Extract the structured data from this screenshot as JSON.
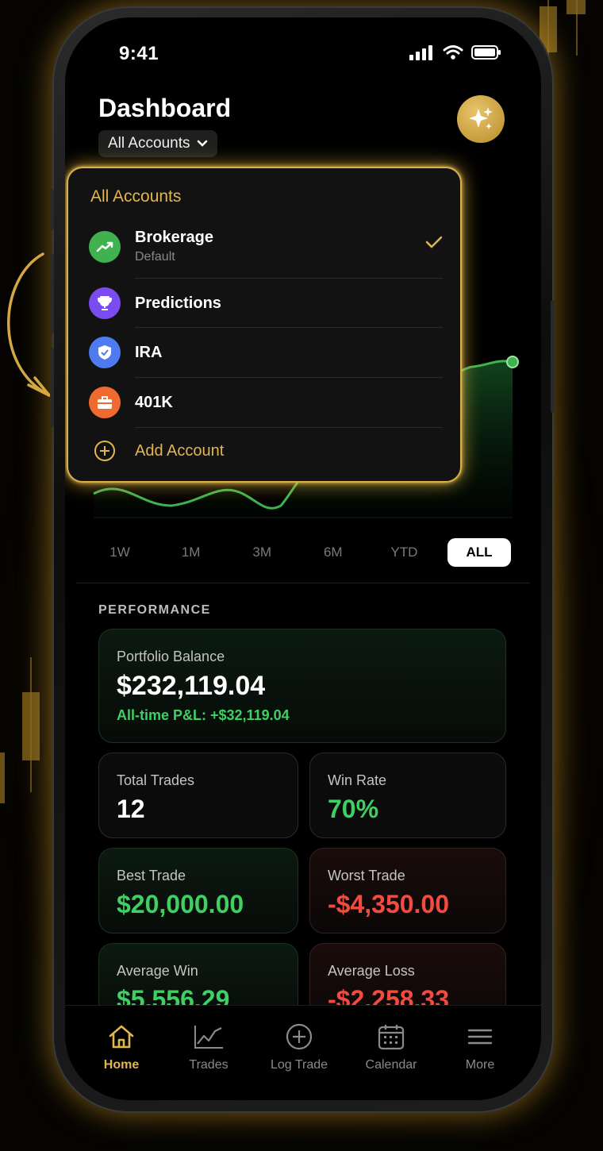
{
  "status_bar": {
    "time": "9:41"
  },
  "header": {
    "title": "Dashboard",
    "account_selector": "All Accounts"
  },
  "account_menu": {
    "header": "All Accounts",
    "items": [
      {
        "label": "Brokerage",
        "sublabel": "Default",
        "icon": "chart-up-icon",
        "color": "#3fb24f",
        "selected": true
      },
      {
        "label": "Predictions",
        "icon": "trophy-icon",
        "color": "#7a4cf0",
        "selected": false
      },
      {
        "label": "IRA",
        "icon": "shield-icon",
        "color": "#4f7bf0",
        "selected": false
      },
      {
        "label": "401K",
        "icon": "briefcase-icon",
        "color": "#ef6a2f",
        "selected": false
      }
    ],
    "add_label": "Add Account"
  },
  "time_ranges": [
    "1W",
    "1M",
    "3M",
    "6M",
    "YTD",
    "ALL"
  ],
  "active_range": "ALL",
  "performance": {
    "section_label": "PERFORMANCE",
    "portfolio": {
      "label": "Portfolio Balance",
      "value": "$232,119.04",
      "pnl": "All-time P&L: +$32,119.04"
    },
    "total_trades": {
      "label": "Total Trades",
      "value": "12"
    },
    "win_rate": {
      "label": "Win Rate",
      "value": "70%"
    },
    "best_trade": {
      "label": "Best Trade",
      "value": "$20,000.00"
    },
    "worst_trade": {
      "label": "Worst Trade",
      "value": "-$4,350.00"
    },
    "average_win": {
      "label": "Average Win",
      "value": "$5,556.29"
    },
    "average_loss": {
      "label": "Average Loss",
      "value": "-$2,258.33"
    }
  },
  "tabs": [
    {
      "label": "Home",
      "icon": "home-icon",
      "active": true
    },
    {
      "label": "Trades",
      "icon": "trend-chart-icon",
      "active": false
    },
    {
      "label": "Log Trade",
      "icon": "plus-circle-icon",
      "active": false
    },
    {
      "label": "Calendar",
      "icon": "calendar-icon",
      "active": false
    },
    {
      "label": "More",
      "icon": "menu-icon",
      "active": false
    }
  ],
  "colors": {
    "accent_gold": "#e2b54e",
    "gain_green": "#3fcf62",
    "loss_red": "#f24c41"
  }
}
